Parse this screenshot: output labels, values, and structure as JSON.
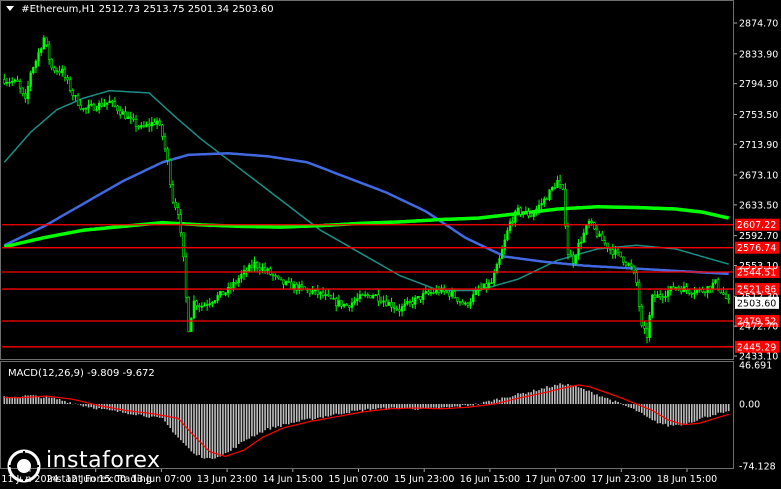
{
  "header": {
    "symbol": "#Ethereum,H1",
    "ohlc": "2512.73 2513.75 2501.34 2503.60"
  },
  "macd": {
    "label": "MACD(12,26,9) -9.809 -9.672"
  },
  "logo": {
    "name": "instaforex",
    "tagline": "Instant Forex Trading"
  },
  "colors": {
    "background": "#000000",
    "bull": "#00ff00",
    "bear": "#00ff00",
    "ma_fast": "#1b8f86",
    "ma_mid": "#4169e1",
    "ma_slow": "#00ff00",
    "levels": "#ff0000",
    "macd_hist": "#c0c0c0",
    "macd_signal": "#ff0000",
    "price_label": "#ffffff",
    "axis_text": "#ffffff",
    "grid": "#1e1e1e"
  },
  "chart_data": {
    "type": "candlestick",
    "ylim": [
      2433.1,
      2892.0
    ],
    "price_ticks": [
      "2874.70",
      "2833.90",
      "2794.30",
      "2753.50",
      "2713.90",
      "2673.10",
      "2633.50",
      "2592.70",
      "2553.10",
      "2512.30",
      "2472.70",
      "2433.10"
    ],
    "time_ticks": [
      "11 Jun 2024",
      "12 Jun 15:00",
      "13 Jun 07:00",
      "13 Jun 23:00",
      "14 Jun 15:00",
      "15 Jun 07:00",
      "15 Jun 23:00",
      "16 Jun 15:00",
      "17 Jun 07:00",
      "17 Jun 23:00",
      "18 Jun 15:00"
    ],
    "current_price": "2503.60",
    "horizontal_levels": [
      {
        "value": 2607.22,
        "label": "2607.22"
      },
      {
        "value": 2576.74,
        "label": "2576.74"
      },
      {
        "value": 2544.51,
        "label": "2544.51"
      },
      {
        "value": 2521.86,
        "label": "2521.86"
      },
      {
        "value": 2479.52,
        "label": "2479.52"
      },
      {
        "value": 2445.29,
        "label": "2445.29"
      }
    ],
    "close_anchors": [
      [
        0,
        2800
      ],
      [
        5,
        2795
      ],
      [
        8,
        2770
      ],
      [
        10,
        2810
      ],
      [
        12,
        2825
      ],
      [
        15,
        2855
      ],
      [
        18,
        2815
      ],
      [
        22,
        2810
      ],
      [
        26,
        2780
      ],
      [
        30,
        2760
      ],
      [
        35,
        2765
      ],
      [
        40,
        2770
      ],
      [
        45,
        2755
      ],
      [
        48,
        2745
      ],
      [
        52,
        2735
      ],
      [
        55,
        2740
      ],
      [
        58,
        2745
      ],
      [
        60,
        2725
      ],
      [
        62,
        2690
      ],
      [
        64,
        2640
      ],
      [
        66,
        2625
      ],
      [
        68,
        2560
      ],
      [
        69,
        2510
      ],
      [
        70,
        2470
      ],
      [
        72,
        2505
      ],
      [
        75,
        2500
      ],
      [
        80,
        2510
      ],
      [
        85,
        2520
      ],
      [
        90,
        2540
      ],
      [
        95,
        2555
      ],
      [
        100,
        2545
      ],
      [
        105,
        2530
      ],
      [
        110,
        2525
      ],
      [
        115,
        2520
      ],
      [
        120,
        2515
      ],
      [
        125,
        2505
      ],
      [
        130,
        2500
      ],
      [
        135,
        2510
      ],
      [
        140,
        2515
      ],
      [
        145,
        2505
      ],
      [
        150,
        2495
      ],
      [
        155,
        2505
      ],
      [
        160,
        2515
      ],
      [
        165,
        2520
      ],
      [
        170,
        2515
      ],
      [
        175,
        2500
      ],
      [
        180,
        2520
      ],
      [
        185,
        2530
      ],
      [
        188,
        2560
      ],
      [
        192,
        2610
      ],
      [
        195,
        2625
      ],
      [
        200,
        2620
      ],
      [
        205,
        2640
      ],
      [
        208,
        2655
      ],
      [
        210,
        2665
      ],
      [
        212,
        2650
      ],
      [
        214,
        2570
      ],
      [
        216,
        2560
      ],
      [
        218,
        2580
      ],
      [
        222,
        2610
      ],
      [
        226,
        2590
      ],
      [
        230,
        2575
      ],
      [
        234,
        2565
      ],
      [
        238,
        2550
      ],
      [
        240,
        2530
      ],
      [
        242,
        2470
      ],
      [
        244,
        2460
      ],
      [
        246,
        2510
      ],
      [
        250,
        2515
      ],
      [
        255,
        2525
      ],
      [
        260,
        2520
      ],
      [
        265,
        2520
      ],
      [
        270,
        2530
      ],
      [
        273,
        2515
      ],
      [
        275,
        2504
      ]
    ],
    "ma_fast": [
      [
        0,
        2690
      ],
      [
        10,
        2730
      ],
      [
        20,
        2760
      ],
      [
        30,
        2775
      ],
      [
        40,
        2785
      ],
      [
        55,
        2782
      ],
      [
        65,
        2750
      ],
      [
        75,
        2720
      ],
      [
        90,
        2680
      ],
      [
        105,
        2640
      ],
      [
        120,
        2600
      ],
      [
        135,
        2570
      ],
      [
        150,
        2540
      ],
      [
        165,
        2520
      ],
      [
        180,
        2520
      ],
      [
        195,
        2535
      ],
      [
        210,
        2560
      ],
      [
        225,
        2575
      ],
      [
        240,
        2580
      ],
      [
        255,
        2575
      ],
      [
        265,
        2565
      ],
      [
        275,
        2555
      ]
    ],
    "ma_mid": [
      [
        0,
        2580
      ],
      [
        15,
        2605
      ],
      [
        30,
        2635
      ],
      [
        45,
        2665
      ],
      [
        60,
        2690
      ],
      [
        70,
        2700
      ],
      [
        85,
        2702
      ],
      [
        100,
        2698
      ],
      [
        115,
        2690
      ],
      [
        130,
        2670
      ],
      [
        145,
        2650
      ],
      [
        160,
        2625
      ],
      [
        175,
        2590
      ],
      [
        190,
        2565
      ],
      [
        205,
        2558
      ],
      [
        220,
        2553
      ],
      [
        235,
        2550
      ],
      [
        250,
        2547
      ],
      [
        265,
        2544
      ],
      [
        275,
        2542
      ]
    ],
    "ma_slow": [
      [
        0,
        2578
      ],
      [
        15,
        2590
      ],
      [
        30,
        2600
      ],
      [
        45,
        2605
      ],
      [
        60,
        2610
      ],
      [
        75,
        2607
      ],
      [
        90,
        2605
      ],
      [
        105,
        2604
      ],
      [
        120,
        2606
      ],
      [
        135,
        2609
      ],
      [
        150,
        2611
      ],
      [
        165,
        2614
      ],
      [
        180,
        2616
      ],
      [
        195,
        2622
      ],
      [
        210,
        2628
      ],
      [
        225,
        2631
      ],
      [
        240,
        2630
      ],
      [
        255,
        2628
      ],
      [
        265,
        2624
      ],
      [
        275,
        2616
      ]
    ],
    "macd_ylim": [
      -74.128,
      46.691
    ],
    "macd_ticks": [
      "46.691",
      "0.00",
      "-74.128"
    ],
    "macd_anchors": [
      [
        0,
        8
      ],
      [
        10,
        10
      ],
      [
        20,
        6
      ],
      [
        30,
        -2
      ],
      [
        40,
        -8
      ],
      [
        50,
        -12
      ],
      [
        60,
        -18
      ],
      [
        66,
        -40
      ],
      [
        72,
        -60
      ],
      [
        78,
        -66
      ],
      [
        85,
        -58
      ],
      [
        92,
        -42
      ],
      [
        100,
        -30
      ],
      [
        110,
        -22
      ],
      [
        120,
        -16
      ],
      [
        130,
        -10
      ],
      [
        140,
        -6
      ],
      [
        150,
        -5
      ],
      [
        160,
        -6
      ],
      [
        170,
        -4
      ],
      [
        180,
        0
      ],
      [
        190,
        8
      ],
      [
        200,
        15
      ],
      [
        206,
        20
      ],
      [
        212,
        24
      ],
      [
        216,
        22
      ],
      [
        222,
        15
      ],
      [
        228,
        8
      ],
      [
        234,
        0
      ],
      [
        240,
        -8
      ],
      [
        246,
        -20
      ],
      [
        252,
        -26
      ],
      [
        258,
        -24
      ],
      [
        264,
        -18
      ],
      [
        270,
        -12
      ],
      [
        275,
        -10
      ]
    ],
    "candle_count": 276
  }
}
